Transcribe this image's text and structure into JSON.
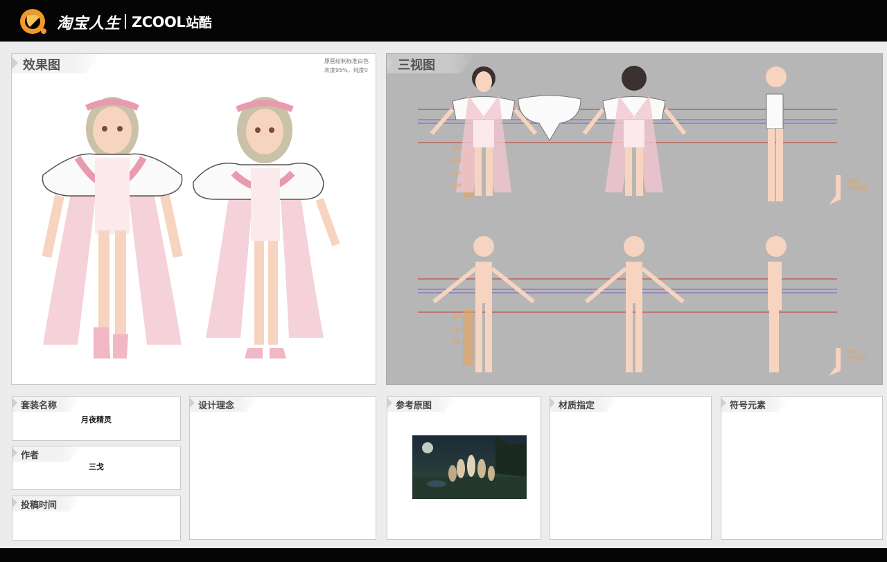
{
  "brand": {
    "taobao": "淘宝人生",
    "zcool_latin": "ZCOOL",
    "zcool_cn": "站酷"
  },
  "panels": {
    "effect": {
      "title": "效果图",
      "note_line1": "原画绘制标准白色",
      "note_line2": "灰度95%，纯度0"
    },
    "three_view": {
      "title": "三视图",
      "proportion_labels": [
        "胸围",
        "五分身",
        "八·九分",
        "大腿",
        "腿长",
        "胸底",
        "脚长"
      ],
      "side_note_line1": "表面贴",
      "side_note_line2": "替换此脚面"
    },
    "suit_name": {
      "title": "套装名称",
      "value": "月夜精灵"
    },
    "author": {
      "title": "作者",
      "value": "三戈"
    },
    "submit_time": {
      "title": "投稿时间",
      "value": ""
    },
    "design_concept": {
      "title": "设计理念"
    },
    "reference": {
      "title": "参考原图"
    },
    "material": {
      "title": "材质指定"
    },
    "symbol": {
      "title": "符号元素"
    }
  },
  "colors": {
    "bar": "#050505",
    "panel_border": "#c9c9c9",
    "three_view_bg": "#b6b6b6",
    "pink": "#f0b8c4",
    "skin": "#f6d4c0",
    "guide_red": "#c0392b",
    "guide_purple": "#7a5cc0",
    "guide_orange": "#e6a45a"
  },
  "icons": [
    "taobao-badge-icon",
    "tab-marker-icon"
  ]
}
